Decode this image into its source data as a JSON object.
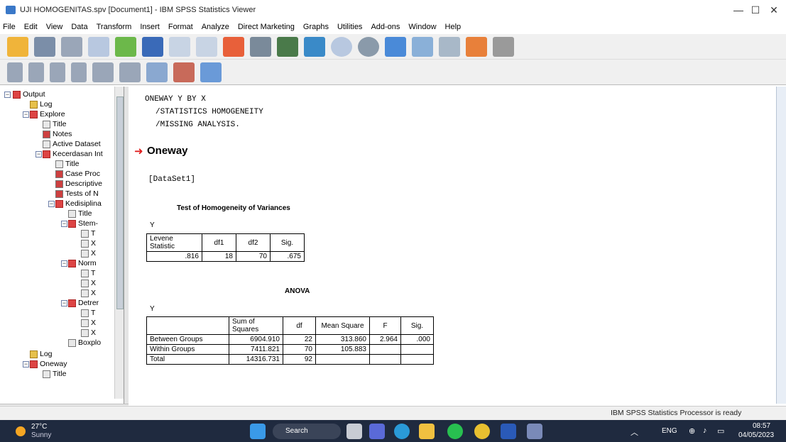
{
  "window": {
    "title": "UJI HOMOGENITAS.spv [Document1] - IBM SPSS Statistics Viewer"
  },
  "menu": [
    "File",
    "Edit",
    "View",
    "Data",
    "Transform",
    "Insert",
    "Format",
    "Analyze",
    "Direct Marketing",
    "Graphs",
    "Utilities",
    "Add-ons",
    "Window",
    "Help"
  ],
  "tree": {
    "items": [
      {
        "label": "Output"
      },
      {
        "label": "Log"
      },
      {
        "label": "Explore"
      },
      {
        "label": "Title"
      },
      {
        "label": "Notes"
      },
      {
        "label": "Active Dataset"
      },
      {
        "label": "Kecerdasan Int"
      },
      {
        "label": "Title"
      },
      {
        "label": "Case Proc"
      },
      {
        "label": "Descriptive"
      },
      {
        "label": "Tests of N"
      },
      {
        "label": "Kedisiplina"
      },
      {
        "label": "Title"
      },
      {
        "label": "Stem-"
      },
      {
        "label": "T"
      },
      {
        "label": "X"
      },
      {
        "label": "X"
      },
      {
        "label": "Norm"
      },
      {
        "label": "T"
      },
      {
        "label": "X"
      },
      {
        "label": "X"
      },
      {
        "label": "Detrer"
      },
      {
        "label": "T"
      },
      {
        "label": "X"
      },
      {
        "label": "X"
      },
      {
        "label": "Boxplo"
      },
      {
        "label": "Log"
      },
      {
        "label": "Oneway"
      },
      {
        "label": "Title"
      }
    ]
  },
  "syntax": {
    "line1": "ONEWAY Y BY X",
    "line2": "/STATISTICS HOMOGENEITY",
    "line3": "/MISSING ANALYSIS."
  },
  "oneway": {
    "heading": "Oneway",
    "dataset": "[DataSet1]"
  },
  "homogeneity": {
    "title": "Test of Homogeneity of Variances",
    "var": "Y",
    "headers": [
      "Levene Statistic",
      "df1",
      "df2",
      "Sig."
    ],
    "row": [
      ".816",
      "18",
      "70",
      ".675"
    ]
  },
  "anova": {
    "title": "ANOVA",
    "var": "Y",
    "headers": [
      "",
      "Sum of Squares",
      "df",
      "Mean Square",
      "F",
      "Sig."
    ],
    "rows": [
      [
        "Between Groups",
        "6904.910",
        "22",
        "313.860",
        "2.964",
        ".000"
      ],
      [
        "Within Groups",
        "7411.821",
        "70",
        "105.883",
        "",
        ""
      ],
      [
        "Total",
        "14316.731",
        "92",
        "",
        "",
        ""
      ]
    ]
  },
  "status": {
    "text": "IBM SPSS Statistics Processor is ready"
  },
  "taskbar": {
    "weather_temp": "27°C",
    "weather_desc": "Sunny",
    "search": "Search",
    "lang": "ENG",
    "time": "08:57",
    "date": "04/05/2023"
  }
}
